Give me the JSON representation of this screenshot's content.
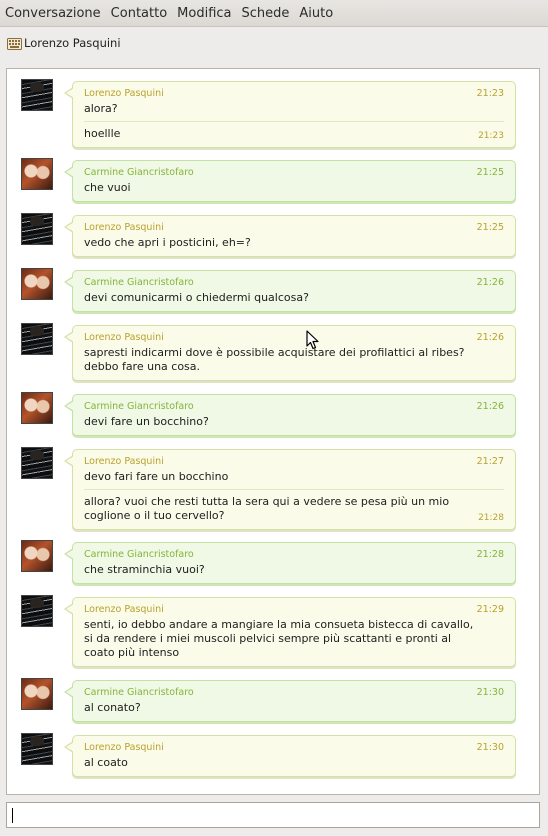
{
  "menu": [
    "Conversazione",
    "Contatto",
    "Modifica",
    "Schede",
    "Aiuto"
  ],
  "tab": {
    "label": "Lorenzo Pasquini",
    "icon": "keyboard-icon"
  },
  "colors": {
    "outgoing_name": "#b9a22d",
    "incoming_name": "#86b43a",
    "outgoing_bg": "#fbfbe9",
    "incoming_bg": "#f0f8e6"
  },
  "messages": [
    {
      "sender": "Lorenzo Pasquini",
      "time": "21:23",
      "text": "alora?",
      "extra": [
        {
          "text": "hoellle",
          "time": "21:23"
        }
      ]
    },
    {
      "sender": "Carmine Giancristofaro",
      "time": "21:25",
      "text": "che vuoi"
    },
    {
      "sender": "Lorenzo Pasquini",
      "time": "21:25",
      "text": "vedo che apri i posticini, eh=?"
    },
    {
      "sender": "Carmine Giancristofaro",
      "time": "21:26",
      "text": "devi comunicarmi o chiedermi qualcosa?"
    },
    {
      "sender": "Lorenzo Pasquini",
      "time": "21:26",
      "text": "sapresti indicarmi dove è possibile acquistare dei profilattici al ribes?\ndebbo fare una cosa."
    },
    {
      "sender": "Carmine Giancristofaro",
      "time": "21:26",
      "text": "devi fare un bocchino?"
    },
    {
      "sender": "Lorenzo Pasquini",
      "time": "21:27",
      "text": "devo fari fare un bocchino",
      "extra": [
        {
          "text": "allora? vuoi che resti tutta la sera qui a vedere se pesa più un mio\ncoglione o il tuo cervello?",
          "time": "21:28"
        }
      ]
    },
    {
      "sender": "Carmine Giancristofaro",
      "time": "21:28",
      "text": "che straminchia vuoi?"
    },
    {
      "sender": "Lorenzo Pasquini",
      "time": "21:29",
      "text": "senti, io debbo andare a mangiare la mia consueta bistecca di cavallo,\nsi da rendere i miei muscoli pelvici sempre più scattanti e pronti al\ncoato più intenso"
    },
    {
      "sender": "Carmine Giancristofaro",
      "time": "21:30",
      "text": "al conato?"
    },
    {
      "sender": "Lorenzo Pasquini",
      "time": "21:30",
      "text": "al coato"
    }
  ],
  "input": {
    "value": ""
  }
}
